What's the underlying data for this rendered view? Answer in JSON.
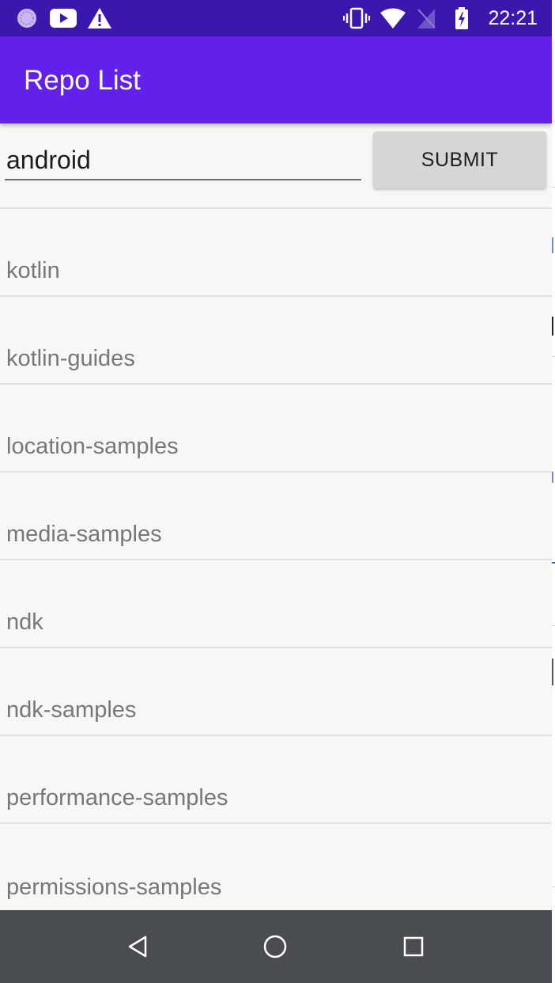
{
  "status_bar": {
    "time": "22:21",
    "left_icons": [
      "app-notification-icon",
      "youtube-icon",
      "warning-icon"
    ],
    "right_icons": [
      "vibrate-icon",
      "wifi-icon",
      "no-sim-icon",
      "battery-charging-icon"
    ]
  },
  "app_bar": {
    "title": "Repo List"
  },
  "search": {
    "value": "android",
    "submit_label": "SUBMIT"
  },
  "repos": [
    {
      "name": "kotlin"
    },
    {
      "name": "kotlin-guides"
    },
    {
      "name": "location-samples"
    },
    {
      "name": "media-samples"
    },
    {
      "name": "ndk"
    },
    {
      "name": "ndk-samples"
    },
    {
      "name": "performance-samples"
    },
    {
      "name": "permissions-samples"
    }
  ],
  "nav_bar": {
    "buttons": [
      "back-icon",
      "home-icon",
      "recents-icon"
    ]
  },
  "colors": {
    "status_bar": "#3c17ad",
    "app_bar": "#6221ea",
    "background": "#f7f8f6",
    "list_text": "#777777",
    "button": "#d6d7d5",
    "nav_bar": "#494d4f"
  }
}
